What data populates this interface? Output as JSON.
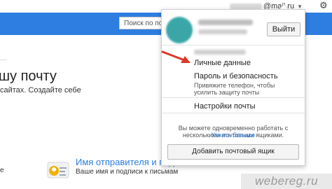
{
  "header": {
    "account_suffix": "@mail.ru",
    "caret": "▼",
    "gear_icon": "gear-icon"
  },
  "search": {
    "placeholder": "Поиск по почт"
  },
  "left": {
    "heading": "шу почту",
    "subtitle": "сайтах. Создайте себе",
    "small": "е"
  },
  "sender": {
    "title": "Имя отправителя и подпись",
    "subtitle": "Ваше имя и подписи к письмам"
  },
  "dropdown": {
    "logout_label": "Выйти",
    "items": [
      {
        "label": "Личные данные"
      },
      {
        "label": "Пароль и безопасность"
      },
      {
        "label": "Настройки почты"
      }
    ],
    "security_note": "Привяжите телефон, чтобы усилить защиту почты",
    "multi_note": "Вы можете одновременно работать с несколькими почтовыми ящиками.",
    "more_link": "Узнать больше",
    "add_button": "Добавить почтовый ящик"
  },
  "colors": {
    "brand_blue": "#2d7ee0",
    "arrow_red": "#d93a2b"
  },
  "watermark": "webereg.ru"
}
